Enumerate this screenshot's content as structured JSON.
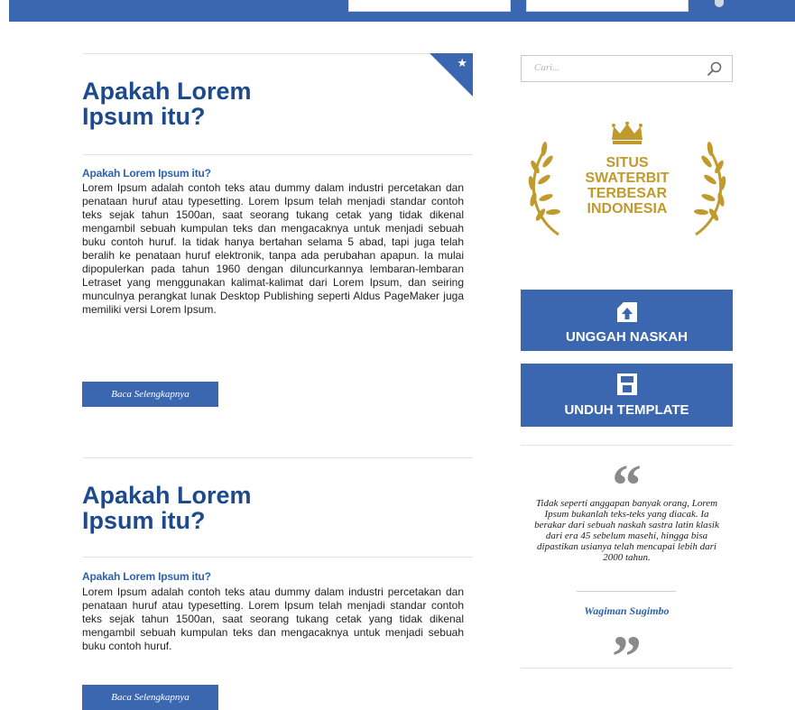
{
  "colors": {
    "accent": "#3a67b0",
    "title": "#1d4a8c",
    "gold": "#c19a2d",
    "quote_mark": "#8a8a8a"
  },
  "articles": [
    {
      "title": "Apakah Lorem Ipsum itu?",
      "subtitle": "Apakah Lorem Ipsum itu?",
      "body": "Lorem Ipsum adalah contoh teks atau dummy dalam industri percetakan dan penataan huruf atau typesetting. Lorem Ipsum telah menjadi standar contoh teks sejak tahun 1500an, saat seorang tukang cetak yang tidak dikenal mengambil sebuah kumpulan teks dan mengacaknya untuk menjadi sebuah buku contoh huruf. Ia tidak hanya bertahan selama 5 abad, tapi juga telah beralih ke penataan huruf elektronik, tanpa ada perubahan apapun. Ia mulai dipopulerkan pada tahun 1960 dengan diluncurkannya lembaran-lembaran Letraset yang menggunakan kalimat-kalimat dari Lorem Ipsum, dan seiring munculnya perangkat lunak Desktop Publishing seperti Aldus PageMaker juga memiliki versi Lorem Ipsum.",
      "button": "Baca Selengkapnya",
      "featured_icon": "star-icon"
    },
    {
      "title": "Apakah Lorem Ipsum itu?",
      "subtitle": "Apakah Lorem Ipsum itu?",
      "body": "Lorem Ipsum adalah contoh teks atau dummy dalam industri percetakan dan penataan huruf atau typesetting. Lorem Ipsum telah menjadi standar contoh teks sejak tahun 1500an, saat seorang tukang cetak yang tidak dikenal mengambil sebuah kumpulan teks dan mengacaknya untuk menjadi sebuah buku contoh huruf.",
      "button": "Baca Selengkapnya"
    }
  ],
  "sidebar": {
    "search": {
      "placeholder": "Cari...",
      "icon": "search-icon"
    },
    "badge": {
      "line1": "SITUS",
      "line2": "SWATERBIT",
      "line3": "TERBESAR",
      "line4": "INDONESIA",
      "icon": "crown-laurel-icon"
    },
    "upload_button": {
      "label": "UNGGAH NASKAH",
      "icon": "upload-icon"
    },
    "download_button": {
      "label": "UNDUH TEMPLATE",
      "icon": "save-icon"
    },
    "quote": {
      "open_mark": "“",
      "close_mark": "”",
      "text": "Tidak seperti anggapan banyak orang, Lorem Ipsum bukanlah teks-teks yang diacak. Ia berakar dari sebuah naskah sastra latin klasik dari era 45 sebelum masehi, hingga bisa dipastikan usianya telah mencapai lebih dari 2000 tahun.",
      "author": "Wagiman Sugimbo"
    }
  }
}
